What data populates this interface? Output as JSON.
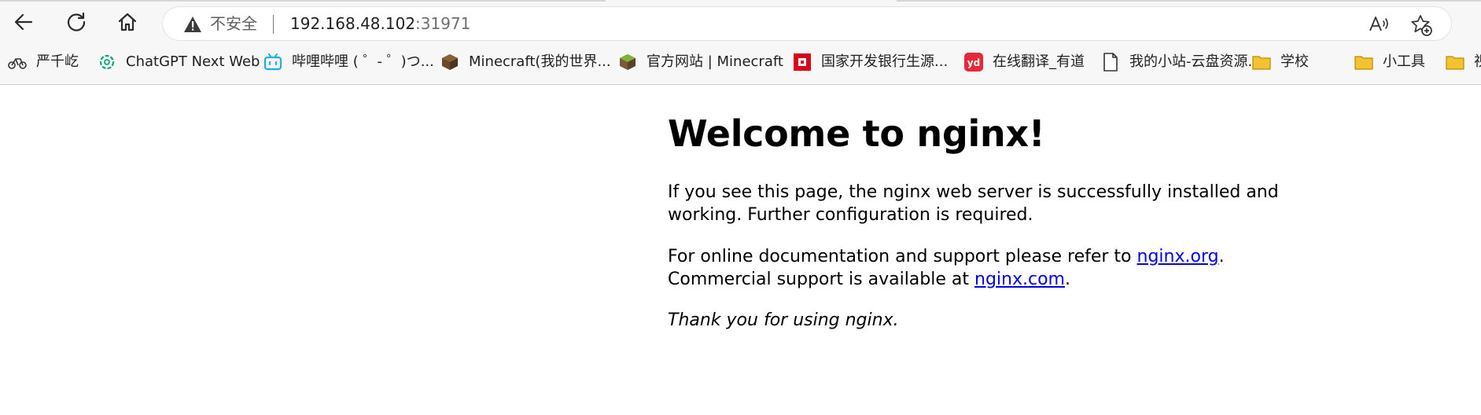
{
  "browser": {
    "address_bar": {
      "security_label": "不安全",
      "url_host": "192.168.48.102",
      "url_port": ":31971"
    },
    "bookmarks": [
      {
        "label": "严千屹",
        "icon": "bike-icon"
      },
      {
        "label": "ChatGPT Next Web",
        "icon": "openai-icon"
      },
      {
        "label": "哔哩哔哩 ( ゜- ゜)つ...",
        "icon": "bilibili-icon"
      },
      {
        "label": "Minecraft(我的世界...",
        "icon": "minecraft-block-icon"
      },
      {
        "label": "官方网站 | Minecraft",
        "icon": "minecraft-grass-icon"
      },
      {
        "label": "国家开发银行生源...",
        "icon": "bank-logo-icon"
      },
      {
        "label": "在线翻译_有道",
        "icon": "youdao-icon"
      },
      {
        "label": "我的小站-云盘资源...",
        "icon": "page-icon"
      },
      {
        "label": "学校",
        "icon": "folder-icon"
      },
      {
        "label": "小工具",
        "icon": "folder-icon"
      },
      {
        "label": "视",
        "icon": "folder-icon"
      }
    ],
    "colors": {
      "folder": "#f4c430",
      "link": "#0000ee",
      "bilibili": "#23ade5",
      "youdao": "#e5283a",
      "bank": "#d9001b"
    }
  },
  "page": {
    "title": "Welcome to nginx!",
    "p1": "If you see this page, the nginx web server is successfully installed and working. Further configuration is required.",
    "p2_prefix": "For online documentation and support please refer to ",
    "p2_link1": "nginx.org",
    "p2_mid": ".",
    "p2_line2_prefix": "Commercial support is available at ",
    "p2_link2": "nginx.com",
    "p2_suffix": ".",
    "p3": "Thank you for using nginx."
  }
}
